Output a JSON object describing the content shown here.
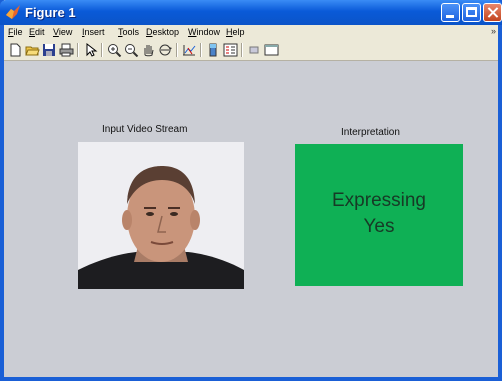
{
  "window": {
    "title": "Figure 1"
  },
  "menu": [
    "File",
    "Edit",
    "View",
    "Insert",
    "Tools",
    "Desktop",
    "Window",
    "Help"
  ],
  "menu_overflow_glyph": "»",
  "toolbar": {
    "icons": [
      "new-file-icon",
      "open-folder-icon",
      "save-icon",
      "print-icon",
      "pointer-icon",
      "zoom-in-icon",
      "zoom-out-icon",
      "pan-hand-icon",
      "rotate-3d-icon",
      "data-cursor-icon",
      "colorbar-icon",
      "legend-icon",
      "hide-plot-tools-icon",
      "show-plot-tools-icon"
    ]
  },
  "axes": {
    "video_title": "Input Video Stream",
    "interpretation_title": "Interpretation"
  },
  "interpretation": {
    "line1": "Expressing",
    "line2": "Yes",
    "color": "#0fb055"
  },
  "colors": {
    "titlebar": "#0a5ad8",
    "figure_bg": "#cbcdd4",
    "menubar_bg": "#ece9d8"
  }
}
